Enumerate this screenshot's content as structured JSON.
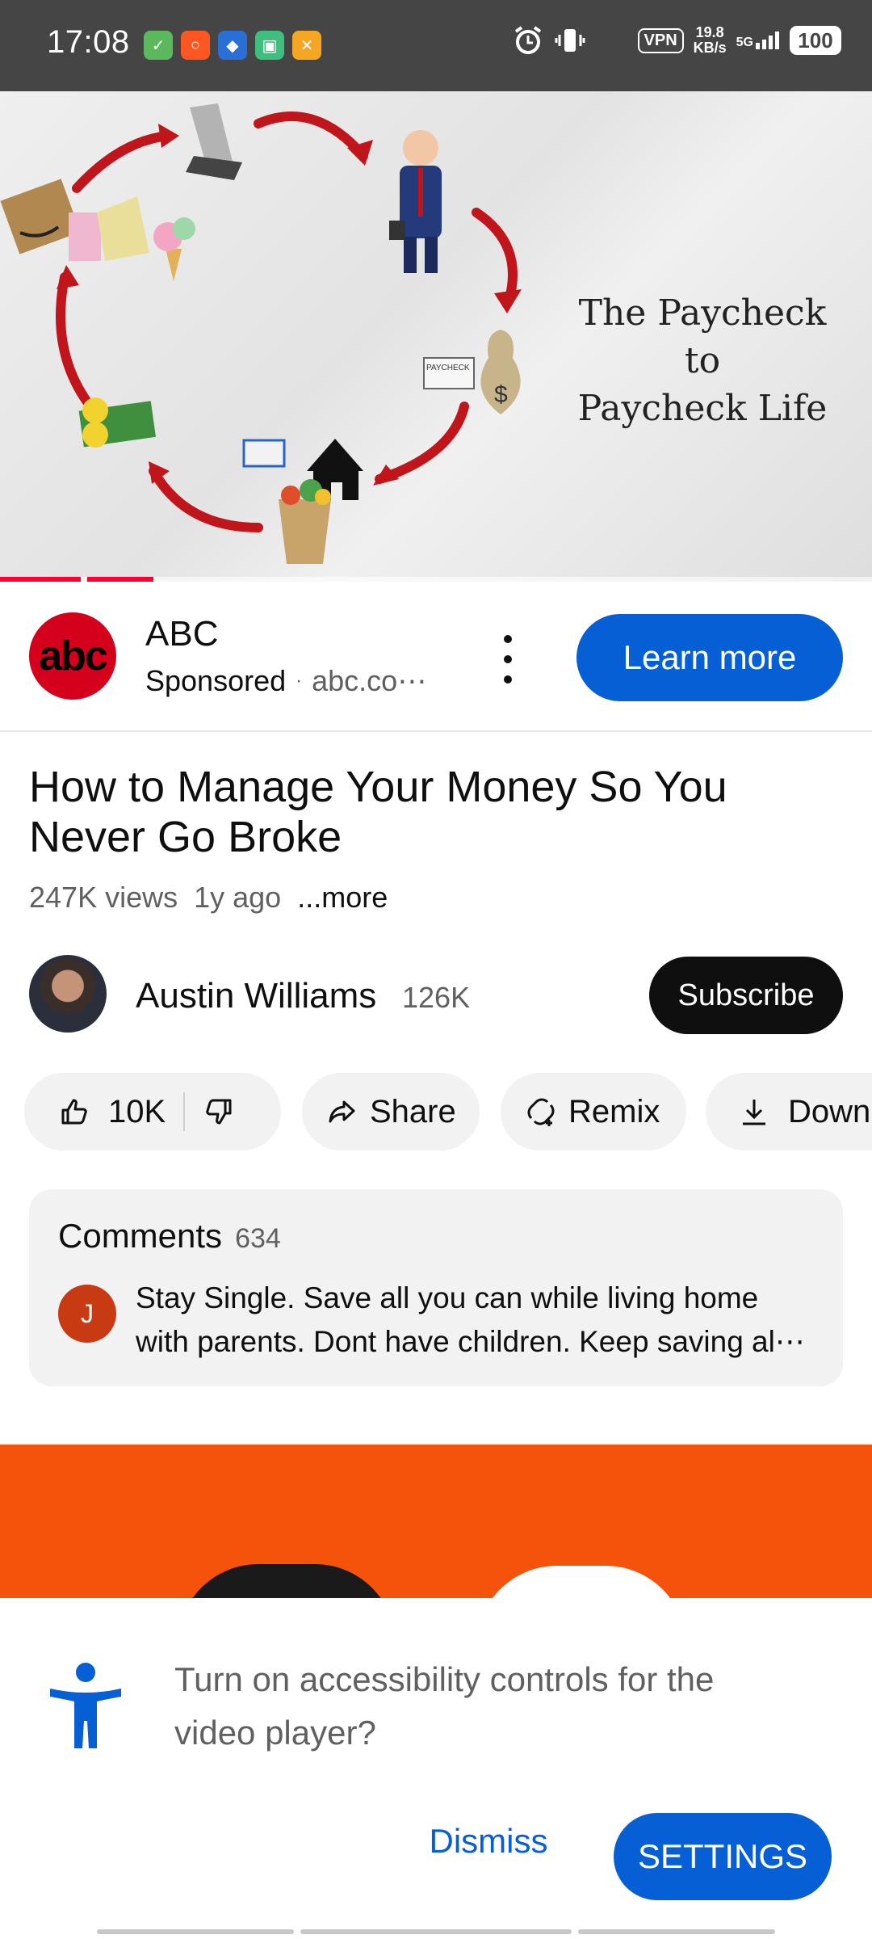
{
  "status_bar": {
    "time": "17:08",
    "vpn": "VPN",
    "speed_value": "19.8",
    "speed_unit": "KB/s",
    "network": "5G",
    "battery": "100"
  },
  "video": {
    "overlay_title_line1": "The Paycheck to",
    "overlay_title_line2": "Paycheck Life",
    "paycheck_label": "PAYCHECK"
  },
  "ad": {
    "logo_text": "abc",
    "name": "ABC",
    "sponsored": "Sponsored",
    "separator": "·",
    "domain": "abc.co⋯",
    "cta": "Learn more"
  },
  "info": {
    "title": "How to Manage Your Money So You Never Go Broke",
    "views": "247K views",
    "age": "1y ago",
    "more": "...more"
  },
  "channel": {
    "name": "Austin Williams",
    "subscribers": "126K",
    "subscribe": "Subscribe"
  },
  "actions": {
    "likes": "10K",
    "share": "Share",
    "remix": "Remix",
    "download": "Down"
  },
  "comments": {
    "title": "Comments",
    "count": "634",
    "avatar_letter": "J",
    "top_comment_line1": "Stay Single. Save all you can while living home",
    "top_comment_line2": "with parents. Dont have children. Keep saving al⋯"
  },
  "sheet": {
    "message": "Turn on accessibility controls for the video player?",
    "dismiss": "Dismiss",
    "settings": "SETTINGS"
  },
  "colors": {
    "accent_blue": "#065fd4",
    "progress_red": "#ff0033",
    "ad_orange": "#f5520c",
    "status_bar": "#454545"
  }
}
